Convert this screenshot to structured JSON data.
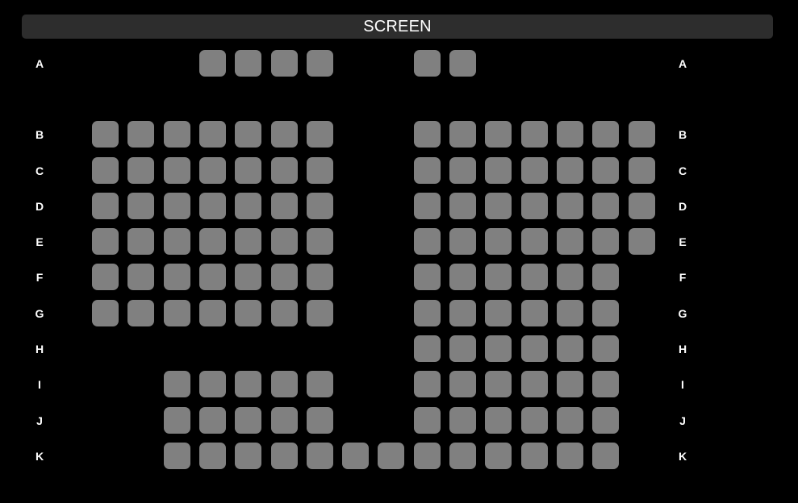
{
  "screen_label": "SCREEN",
  "colors": {
    "background": "#000000",
    "screen_bar": "#2d2d2d",
    "seat_available": "#808080",
    "text": "#ffffff"
  },
  "rows": [
    {
      "label": "A",
      "seats": [
        4,
        5,
        6,
        7,
        10,
        11
      ]
    },
    {
      "label": "B",
      "seats": [
        1,
        2,
        3,
        4,
        5,
        6,
        7,
        10,
        11,
        12,
        13,
        14,
        15,
        16
      ]
    },
    {
      "label": "C",
      "seats": [
        1,
        2,
        3,
        4,
        5,
        6,
        7,
        10,
        11,
        12,
        13,
        14,
        15,
        16
      ]
    },
    {
      "label": "D",
      "seats": [
        1,
        2,
        3,
        4,
        5,
        6,
        7,
        10,
        11,
        12,
        13,
        14,
        15,
        16
      ]
    },
    {
      "label": "E",
      "seats": [
        1,
        2,
        3,
        4,
        5,
        6,
        7,
        10,
        11,
        12,
        13,
        14,
        15,
        16
      ]
    },
    {
      "label": "F",
      "seats": [
        1,
        2,
        3,
        4,
        5,
        6,
        7,
        10,
        11,
        12,
        13,
        14,
        15
      ]
    },
    {
      "label": "G",
      "seats": [
        1,
        2,
        3,
        4,
        5,
        6,
        7,
        10,
        11,
        12,
        13,
        14,
        15
      ]
    },
    {
      "label": "H",
      "seats": [
        10,
        11,
        12,
        13,
        14,
        15
      ]
    },
    {
      "label": "I",
      "seats": [
        3,
        4,
        5,
        6,
        7,
        10,
        11,
        12,
        13,
        14,
        15
      ]
    },
    {
      "label": "J",
      "seats": [
        3,
        4,
        5,
        6,
        7,
        10,
        11,
        12,
        13,
        14,
        15
      ]
    },
    {
      "label": "K",
      "seats": [
        3,
        4,
        5,
        6,
        7,
        8,
        9,
        10,
        11,
        12,
        13,
        14,
        15
      ]
    }
  ]
}
